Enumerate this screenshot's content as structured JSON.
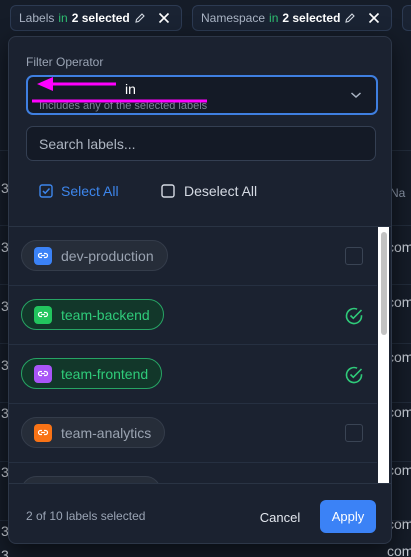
{
  "chips": {
    "labels": {
      "name": "Labels",
      "operator": "in",
      "count": "2 selected"
    },
    "namespace": {
      "name": "Namespace",
      "operator": "in",
      "count": "2 selected"
    }
  },
  "background": {
    "left_values": [
      "3",
      "3",
      "3",
      "3",
      "3",
      "3",
      "3",
      "3"
    ],
    "right_values": [
      "com",
      "com",
      "com",
      "com",
      "com",
      "com",
      "com"
    ],
    "header_fragment": "Na"
  },
  "filter": {
    "operator_title": "Filter Operator",
    "operator_value": "in",
    "operator_desc": "Includes any of the selected labels",
    "search_placeholder": "Search labels...",
    "select_all": "Select All",
    "deselect_all": "Deselect All"
  },
  "labels": [
    {
      "name": "dev-production",
      "selected": false,
      "icon_color": "#3b82f6"
    },
    {
      "name": "team-backend",
      "selected": true,
      "icon_color": "#22c55e"
    },
    {
      "name": "team-frontend",
      "selected": true,
      "icon_color": "#a855f7"
    },
    {
      "name": "team-analytics",
      "selected": false,
      "icon_color": "#f97316"
    },
    {
      "name": "",
      "selected": false,
      "icon_color": "#ef4444"
    }
  ],
  "footer": {
    "status": "2 of 10 labels selected",
    "cancel": "Cancel",
    "apply": "Apply"
  },
  "colors": {
    "accent": "#3b82f6",
    "selected_green": "#2fcb7a",
    "annotation_magenta": "#ff00ff"
  }
}
